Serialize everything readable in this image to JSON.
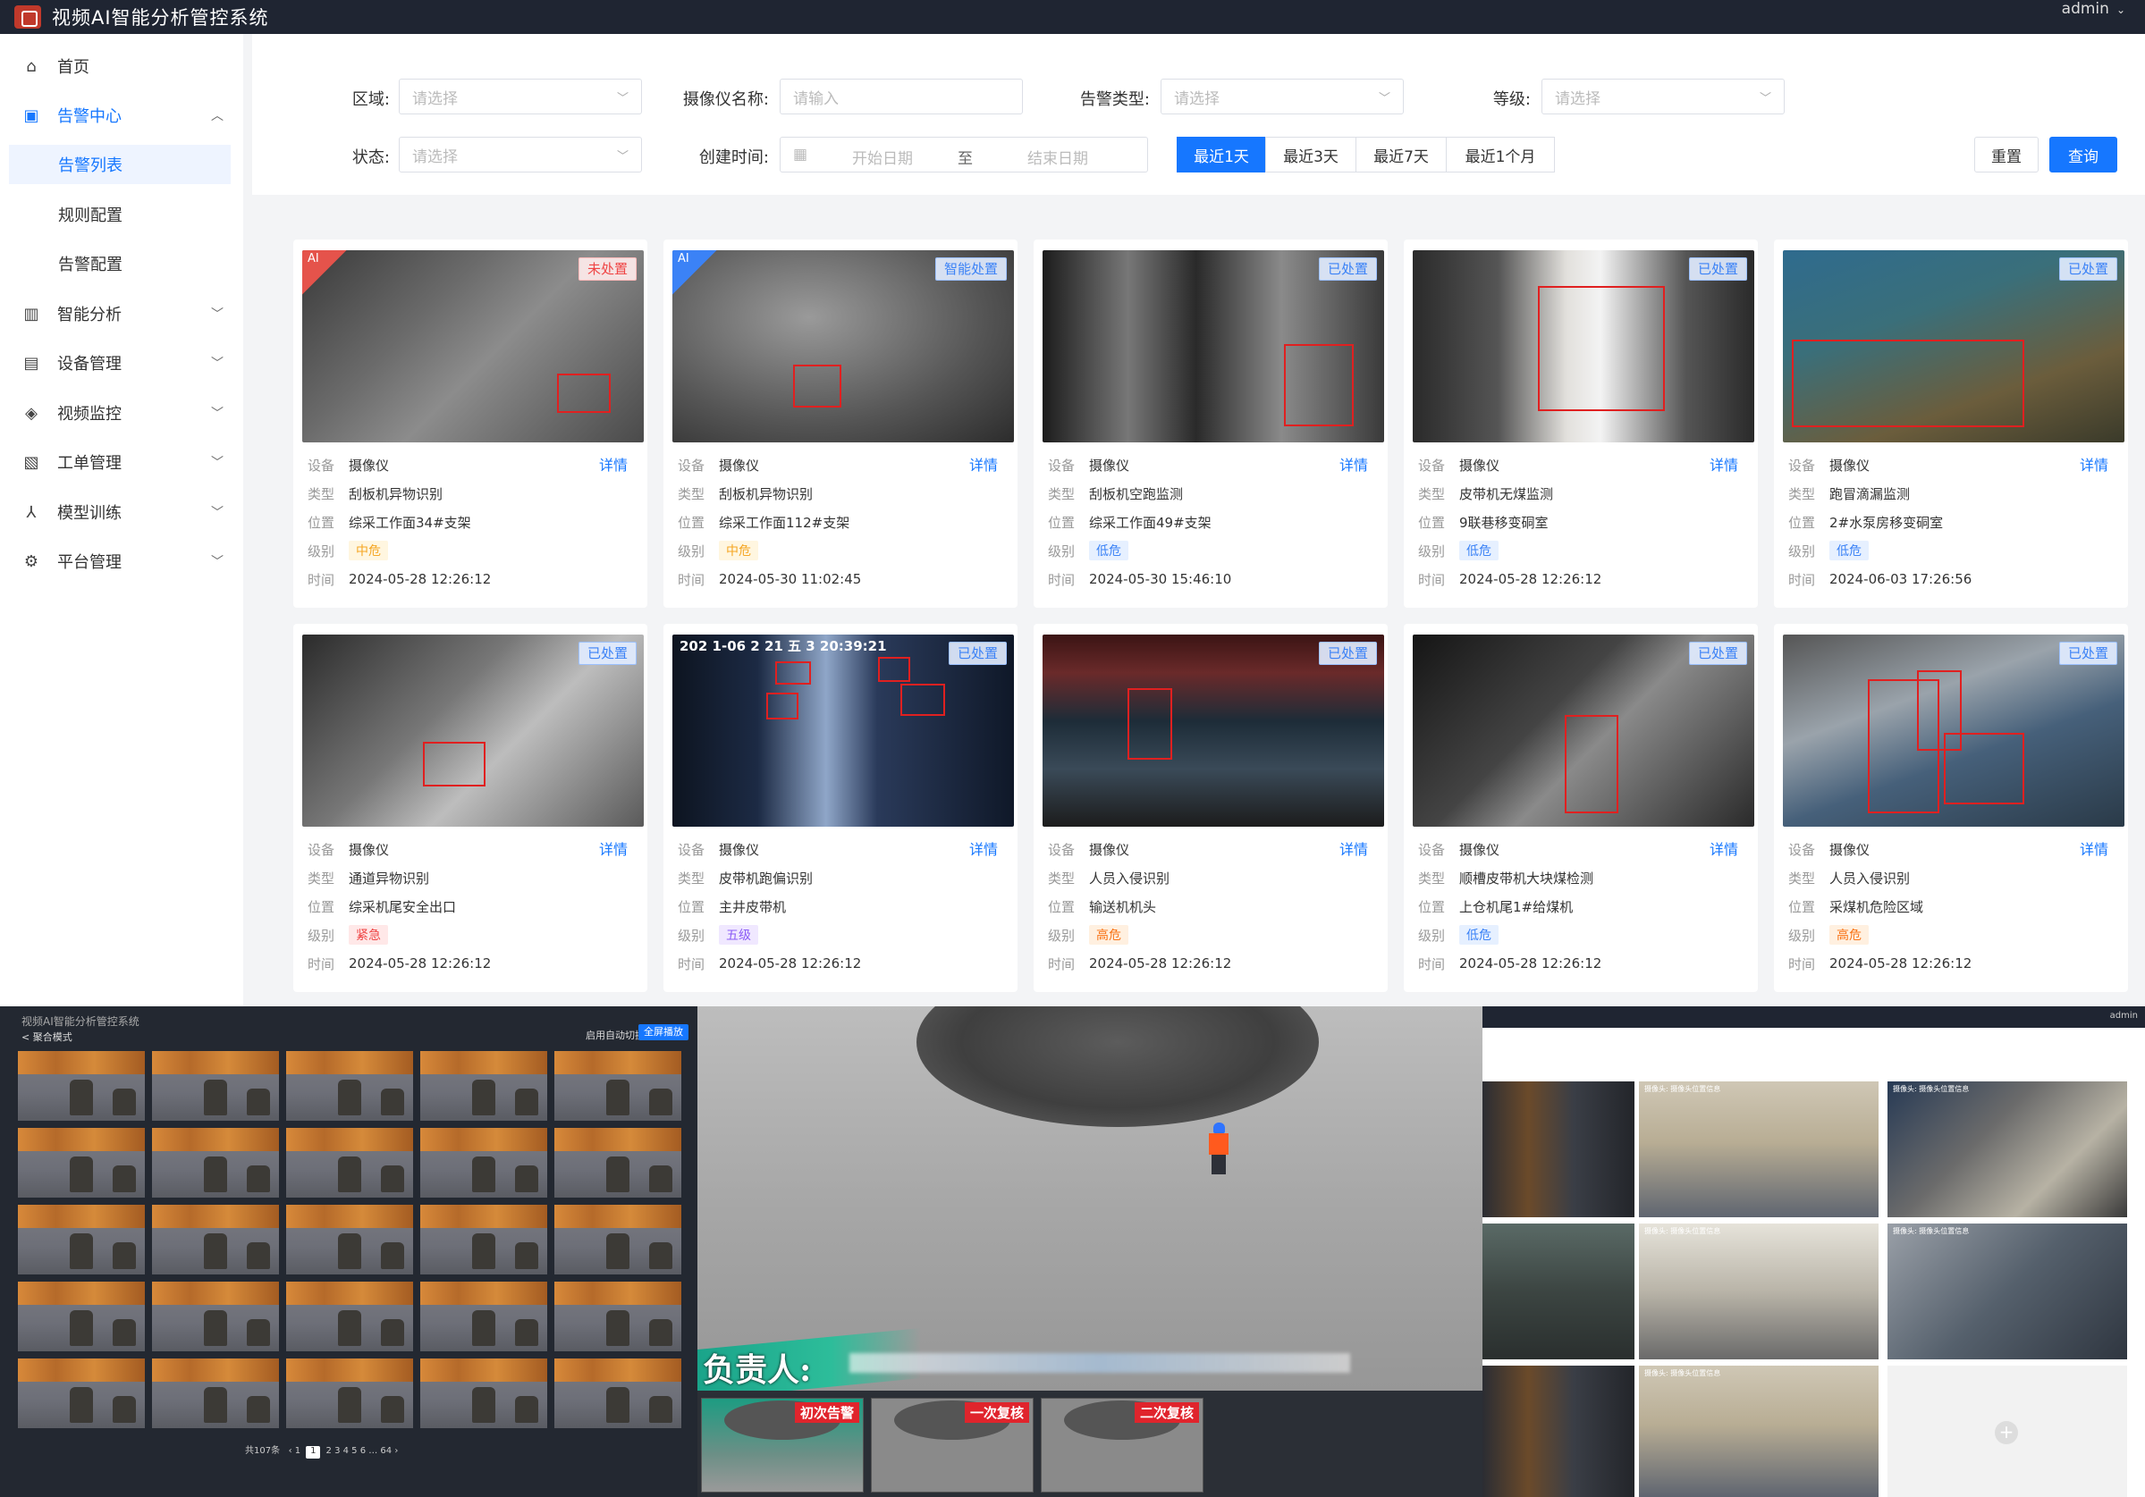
{
  "app": {
    "title": "视频AI智能分析管控系统",
    "user": "admin"
  },
  "sidebar": {
    "items": [
      {
        "label": "首页"
      },
      {
        "label": "告警中心"
      },
      {
        "label": "智能分析"
      },
      {
        "label": "设备管理"
      },
      {
        "label": "视频监控"
      },
      {
        "label": "工单管理"
      },
      {
        "label": "模型训练"
      },
      {
        "label": "平台管理"
      }
    ],
    "sub": [
      {
        "label": "告警列表"
      },
      {
        "label": "规则配置"
      },
      {
        "label": "告警配置"
      }
    ]
  },
  "filters": {
    "area_label": "区域:",
    "area_placeholder": "请选择",
    "camera_label": "摄像仪名称:",
    "camera_placeholder": "请输入",
    "type_label": "告警类型:",
    "type_placeholder": "请选择",
    "level_label": "等级:",
    "level_placeholder": "请选择",
    "status_label": "状态:",
    "status_placeholder": "请选择",
    "created_label": "创建时间:",
    "start_placeholder": "开始日期",
    "to": "至",
    "end_placeholder": "结束日期",
    "quick": [
      "最近1天",
      "最近3天",
      "最近7天",
      "最近1个月"
    ],
    "reset": "重置",
    "search": "查询"
  },
  "card_labels": {
    "device": "设备",
    "type": "类型",
    "location": "位置",
    "level": "级别",
    "time": "时间",
    "detail": "详情"
  },
  "cards": [
    {
      "status": "未处置",
      "ai": "AI",
      "device": "摄像仪",
      "type": "刮板机异物识别",
      "location": "综采工作面34#支架",
      "level": "中危",
      "level_color": "#f5a623",
      "level_bg": "#fff6e0",
      "time": "2024-05-28 12:26:12"
    },
    {
      "status": "智能处置",
      "ai": "AI",
      "device": "摄像仪",
      "type": "刮板机异物识别",
      "location": "综采工作面112#支架",
      "level": "中危",
      "level_color": "#f5a623",
      "level_bg": "#fff6e0",
      "time": "2024-05-30 11:02:45"
    },
    {
      "status": "已处置",
      "device": "摄像仪",
      "type": "刮板机空跑监测",
      "location": "综采工作面49#支架",
      "level": "低危",
      "level_color": "#3b82f6",
      "level_bg": "#e6f0ff",
      "time": "2024-05-30 15:46:10"
    },
    {
      "status": "已处置",
      "device": "摄像仪",
      "type": "皮带机无煤监测",
      "location": "9联巷移变硐室",
      "level": "低危",
      "level_color": "#3b82f6",
      "level_bg": "#e6f0ff",
      "time": "2024-05-28 12:26:12"
    },
    {
      "status": "已处置",
      "device": "摄像仪",
      "type": "跑冒滴漏监测",
      "location": "2#水泵房移变硐室",
      "level": "低危",
      "level_color": "#3b82f6",
      "level_bg": "#e6f0ff",
      "time": "2024-06-03 17:26:56"
    },
    {
      "status": "已处置",
      "device": "摄像仪",
      "type": "通道异物识别",
      "location": "综采机尾安全出口",
      "level": "紧急",
      "level_color": "#ef4444",
      "level_bg": "#ffe8e8",
      "time": "2024-05-28 12:26:12"
    },
    {
      "status": "已处置",
      "overlay": "202 1-06 2 21 五 3 20:39:21",
      "device": "摄像仪",
      "type": "皮带机跑偏识别",
      "location": "主井皮带机",
      "level": "五级",
      "level_color": "#8b5cf6",
      "level_bg": "#f0e8ff",
      "time": "2024-05-28 12:26:12"
    },
    {
      "status": "已处置",
      "device": "摄像仪",
      "type": "人员入侵识别",
      "location": "输送机机头",
      "level": "高危",
      "level_color": "#f97316",
      "level_bg": "#fff0e0",
      "time": "2024-05-28 12:26:12"
    },
    {
      "status": "已处置",
      "device": "摄像仪",
      "type": "顺槽皮带机大块煤检测",
      "location": "上仓机尾1#给煤机",
      "level": "低危",
      "level_color": "#3b82f6",
      "level_bg": "#e6f0ff",
      "time": "2024-05-28 12:26:12"
    },
    {
      "status": "已处置",
      "device": "摄像仪",
      "type": "人员入侵识别",
      "location": "采煤机危险区域",
      "level": "高危",
      "level_color": "#f97316",
      "level_bg": "#fff0e0",
      "time": "2024-05-28 12:26:12"
    }
  ],
  "grid_panel": {
    "title": "视频AI智能分析管控系统",
    "mode": "< 聚合模式",
    "checkbox": "启用自动切换",
    "button": "全屏播放",
    "pager": "共107条"
  },
  "yard_panel": {
    "responsible": "负责人:",
    "tags": [
      "初次告警",
      "一次复核",
      "二次复核"
    ]
  },
  "cams_panel": {
    "user": "admin",
    "caption": "摄像头: 摄像头位置信息"
  }
}
